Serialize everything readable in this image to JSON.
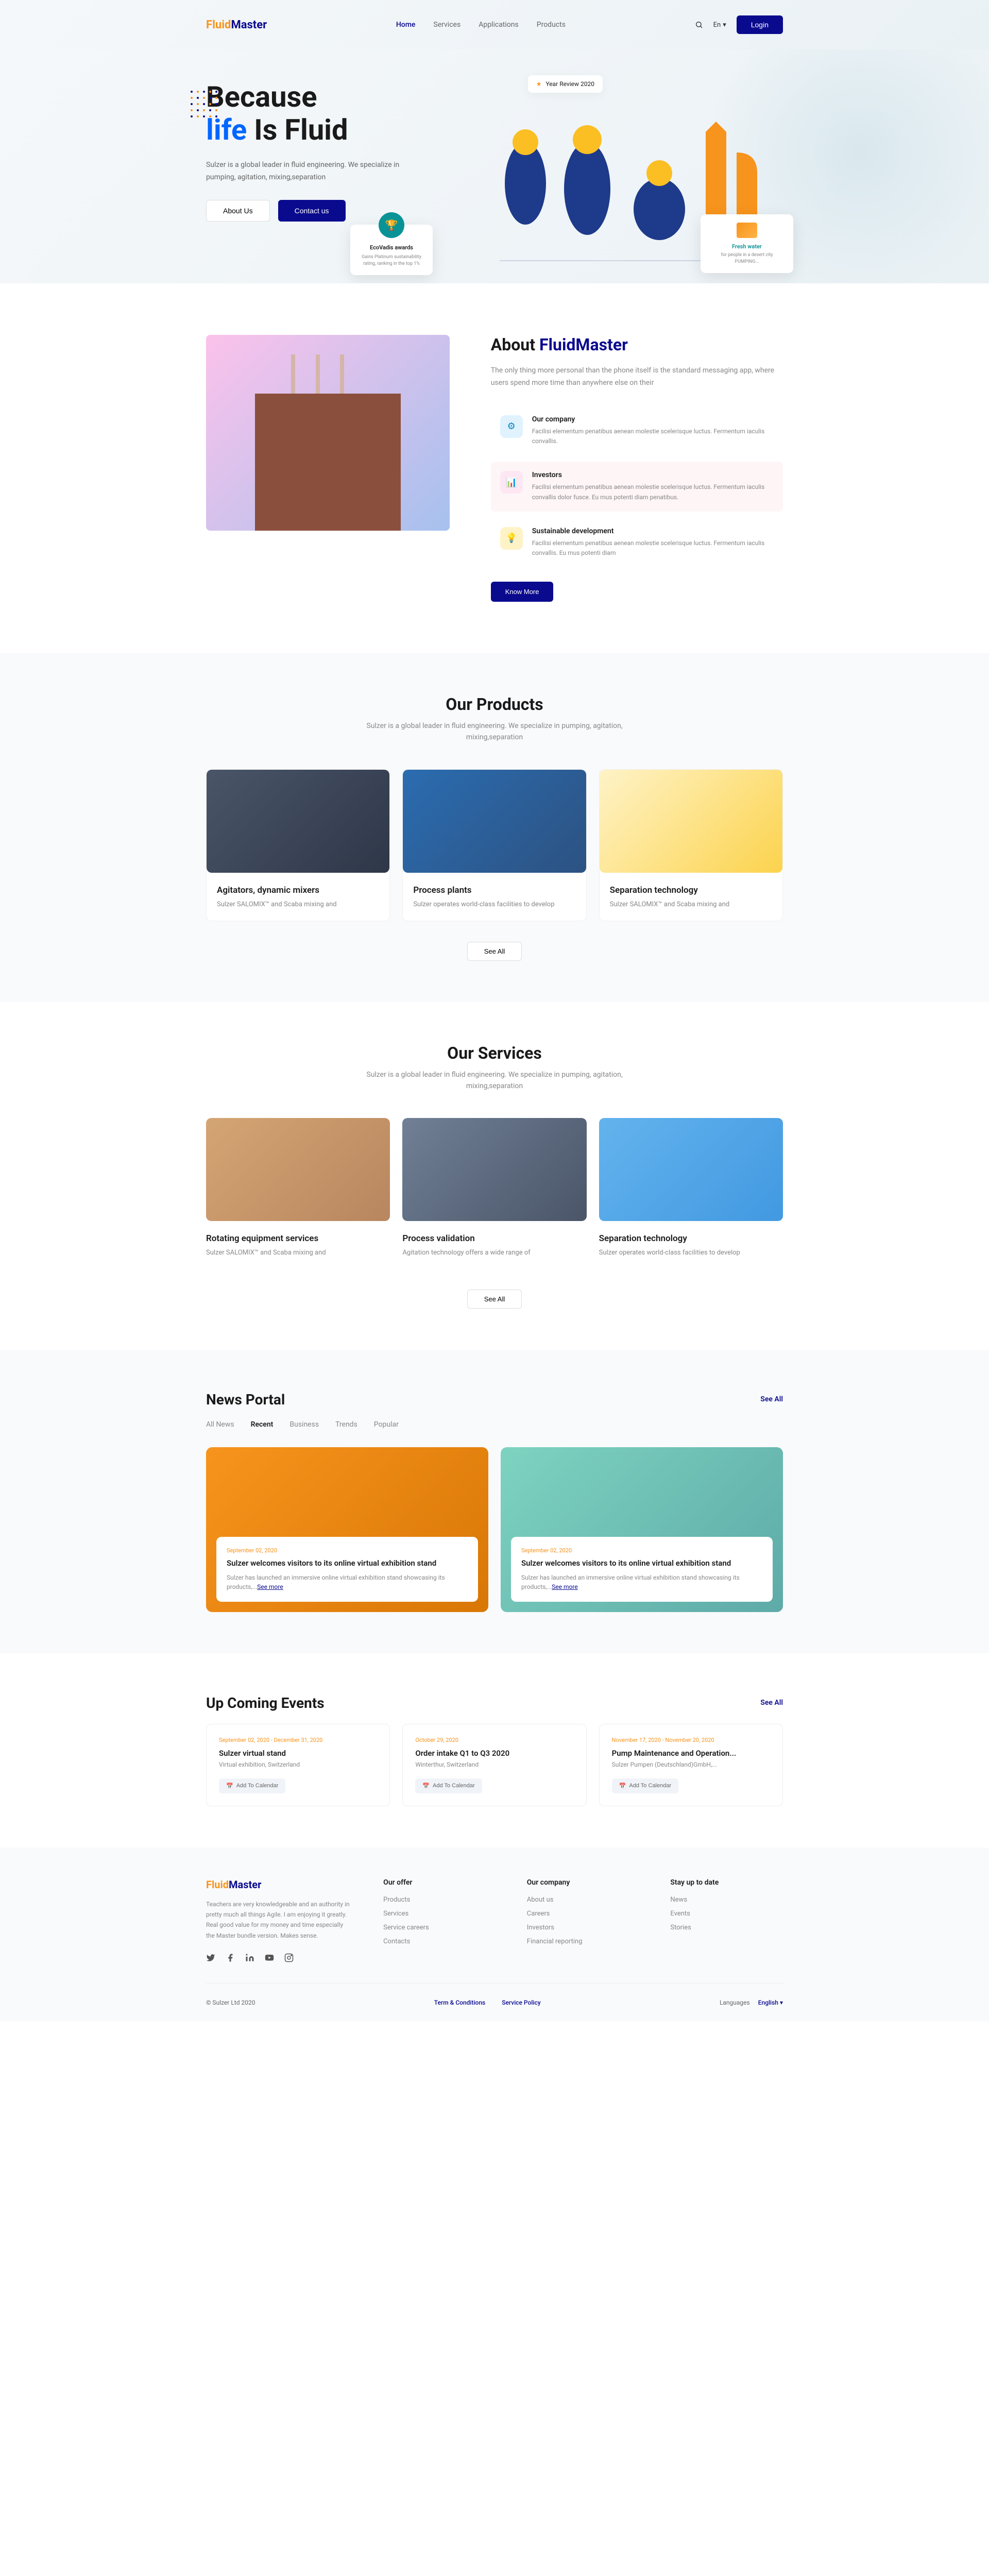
{
  "brand": {
    "part1": "Fluid",
    "part2": "Master"
  },
  "nav": {
    "home": "Home",
    "services": "Services",
    "applications": "Applications",
    "products": "Products",
    "lang": "En",
    "login": "Login"
  },
  "hero": {
    "yearReview": "Year Review 2020",
    "title1": "Because",
    "title2_life": "life",
    "title2_rest": " Is Fluid",
    "subtitle": "Sulzer is a global leader in fluid engineering. We specialize in pumping, agitation, mixing,separation",
    "aboutBtn": "About Us",
    "contactBtn": "Contact us",
    "awardLeft": {
      "title": "EcoVadis awards",
      "desc": "Gains Platinum sustainability rating, ranking in the top 1%"
    },
    "awardRight": {
      "title": "Fresh water",
      "desc": "for people in a desert city PUMPING..."
    }
  },
  "about": {
    "titlePrefix": "About ",
    "desc": "The only thing more personal than the phone itself is the standard messaging app, where users spend more time than anywhere else on their",
    "features": [
      {
        "title": "Our company",
        "desc": "Facilisi elementum penatibus aenean molestie scelerisque luctus. Fermentum iaculis convallis."
      },
      {
        "title": "Investors",
        "desc": "Facilisi elementum penatibus aenean molestie scelerisque luctus. Fermentum iaculis convallis dolor fusce. Eu mus potenti diam penatibus."
      },
      {
        "title": "Sustainable development",
        "desc": "Facilisi elementum penatibus aenean molestie scelerisque luctus. Fermentum iaculis convallis. Eu mus potenti diam"
      }
    ],
    "knowMore": "Know More"
  },
  "products": {
    "title": "Our Products",
    "subtitle": "Sulzer is a global leader in fluid engineering. We specialize in pumping, agitation, mixing,separation",
    "items": [
      {
        "title": "Agitators, dynamic mixers",
        "desc": "Sulzer SALOMIX™ and Scaba mixing and"
      },
      {
        "title": "Process plants",
        "desc": "Sulzer operates world-class facilities to develop"
      },
      {
        "title": "Separation technology",
        "desc": "Sulzer SALOMIX™ and Scaba mixing and"
      }
    ],
    "seeAll": "See All"
  },
  "services": {
    "title": "Our Services",
    "subtitle": "Sulzer is a global leader in fluid engineering. We specialize in pumping, agitation, mixing,separation",
    "items": [
      {
        "title": "Rotating equipment services",
        "desc": "Sulzer SALOMIX™ and Scaba mixing and"
      },
      {
        "title": "Process validation",
        "desc": "Agitation technology offers a wide range of"
      },
      {
        "title": "Separation technology",
        "desc": "Sulzer operates world-class facilities to develop"
      }
    ],
    "seeAll": "See All"
  },
  "news": {
    "title": "News Portal",
    "seeAll": "See All",
    "tabs": [
      "All News",
      "Recent",
      "Business",
      "Trends",
      "Popular"
    ],
    "items": [
      {
        "date": "September 02, 2020",
        "title": "Sulzer welcomes visitors to its online virtual exhibition stand",
        "excerpt": "Sulzer has launched an immersive online virtual exhibition stand showcasing its products,...",
        "more": "See more"
      },
      {
        "date": "September 02, 2020",
        "title": "Sulzer welcomes visitors to its online virtual exhibition stand",
        "excerpt": "Sulzer has launched an immersive online virtual exhibition stand showcasing its products,...",
        "more": "See more"
      }
    ]
  },
  "events": {
    "title": "Up Coming Events",
    "seeAll": "See All",
    "items": [
      {
        "date": "September 02, 2020 - December 31, 2020",
        "title": "Sulzer virtual stand",
        "location": "Virtual exhibition, Switzerland",
        "btn": "Add To Calendar"
      },
      {
        "date": "October 29, 2020",
        "title": "Order intake Q1 to Q3 2020",
        "location": "Winterthur, Switzerland",
        "btn": "Add To Calendar"
      },
      {
        "date": "November 17, 2020 - November 20, 2020",
        "title": "Pump Maintenance and Operation...",
        "location": "Sulzer Pumpen (Deutschland)GmbH,...",
        "btn": "Add To Calendar"
      }
    ]
  },
  "footer": {
    "desc": "Teachers are very knowledgeable and an authority in pretty much all things Agile. I am enjoying it greatly. Real good value for my money and time especially the Master bundle version. Makes sense.",
    "cols": {
      "offer": {
        "title": "Our offer",
        "links": [
          "Products",
          "Services",
          "Service careers",
          "Contacts"
        ]
      },
      "company": {
        "title": "Our company",
        "links": [
          "About us",
          "Careers",
          "Investors",
          "Financial reporting"
        ]
      },
      "stay": {
        "title": "Stay up to date",
        "links": [
          "News",
          "Events",
          "Stories"
        ]
      }
    },
    "copyright": "© Sulzer Ltd 2020",
    "terms": "Term & Conditions",
    "service": "Service Policy",
    "langLabel": "Languages",
    "langValue": "English"
  }
}
